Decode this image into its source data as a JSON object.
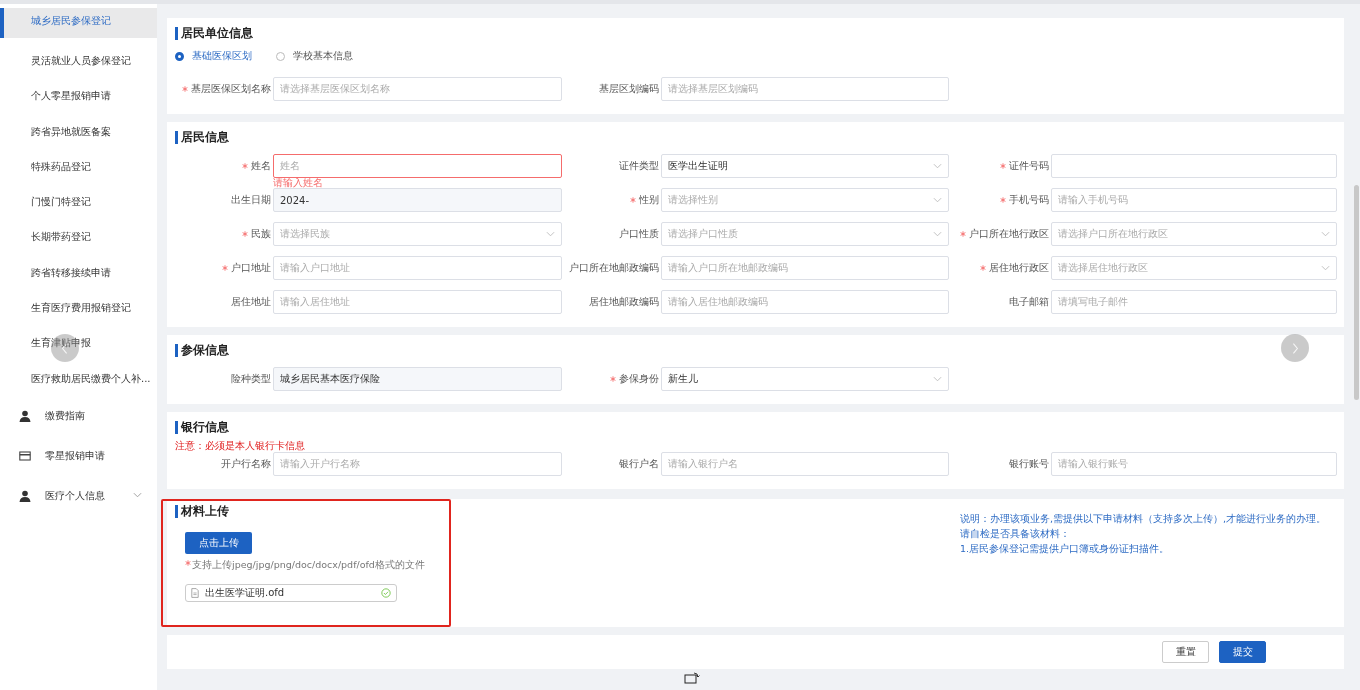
{
  "sidebar": {
    "items": [
      {
        "label": "城乡居民参保登记",
        "selected": true
      },
      {
        "label": "灵活就业人员参保登记",
        "selected": false
      },
      {
        "label": "个人零星报销申请",
        "selected": false
      },
      {
        "label": "跨省异地就医备案",
        "selected": false
      },
      {
        "label": "特殊药品登记",
        "selected": false
      },
      {
        "label": "门慢门特登记",
        "selected": false
      },
      {
        "label": "长期带药登记",
        "selected": false
      },
      {
        "label": "跨省转移接续申请",
        "selected": false
      },
      {
        "label": "生育医疗费用报销登记",
        "selected": false
      },
      {
        "label": "生育津贴申报",
        "selected": false
      },
      {
        "label": "医疗救助居民缴费个人补...",
        "selected": false
      }
    ],
    "menus": [
      {
        "kind": "person",
        "label": "缴费指南",
        "expandable": false
      },
      {
        "kind": "card",
        "label": "零星报销申请",
        "expandable": false
      },
      {
        "kind": "person",
        "label": "医疗个人信息",
        "expandable": true
      }
    ]
  },
  "sections": [
    {
      "title": "居民单位信息",
      "radios": [
        {
          "label": "基础医保区划",
          "selected": true
        },
        {
          "label": "学校基本信息",
          "selected": false
        }
      ],
      "fields": [
        {
          "label": "基层医保区划名称",
          "required": true,
          "kind": "input",
          "placeholder": "请选择基层医保区划名称"
        },
        {
          "label": "基层区划编码",
          "required": false,
          "kind": "input",
          "placeholder": "请选择基层区划编码"
        }
      ]
    },
    {
      "title": "居民信息",
      "fields": [
        {
          "label": "姓名",
          "required": true,
          "kind": "input",
          "placeholder": "姓名",
          "error": "请输入姓名"
        },
        {
          "label": "证件类型",
          "required": false,
          "kind": "select",
          "value": "医学出生证明"
        },
        {
          "label": "证件号码",
          "required": true,
          "kind": "input"
        },
        {
          "label": "出生日期",
          "required": false,
          "kind": "readonly",
          "value": "2024-"
        },
        {
          "label": "性别",
          "required": true,
          "kind": "select",
          "placeholder": "请选择性别"
        },
        {
          "label": "手机号码",
          "required": true,
          "kind": "input",
          "placeholder": "请输入手机号码"
        },
        {
          "label": "民族",
          "required": true,
          "kind": "select",
          "placeholder": "请选择民族"
        },
        {
          "label": "户口性质",
          "required": false,
          "kind": "select",
          "placeholder": "请选择户口性质"
        },
        {
          "label": "户口所在地行政区",
          "required": true,
          "kind": "select",
          "placeholder": "请选择户口所在地行政区"
        },
        {
          "label": "户口地址",
          "required": true,
          "kind": "input",
          "placeholder": "请输入户口地址"
        },
        {
          "label": "户口所在地邮政编码",
          "required": false,
          "kind": "input",
          "placeholder": "请输入户口所在地邮政编码"
        },
        {
          "label": "居住地行政区",
          "required": true,
          "kind": "select",
          "placeholder": "请选择居住地行政区"
        },
        {
          "label": "居住地址",
          "required": false,
          "kind": "input",
          "placeholder": "请输入居住地址"
        },
        {
          "label": "居住地邮政编码",
          "required": false,
          "kind": "input",
          "placeholder": "请输入居住地邮政编码"
        },
        {
          "label": "电子邮箱",
          "required": false,
          "kind": "input",
          "placeholder": "请填写电子邮件"
        }
      ]
    },
    {
      "title": "参保信息",
      "fields": [
        {
          "label": "险种类型",
          "required": false,
          "kind": "readonly",
          "value": "城乡居民基本医疗保险"
        },
        {
          "label": "参保身份",
          "required": true,
          "kind": "select",
          "value": "新生儿"
        }
      ]
    },
    {
      "title": "银行信息",
      "notice": "注意：必须是本人银行卡信息",
      "fields": [
        {
          "label": "开户行名称",
          "required": false,
          "kind": "input",
          "placeholder": "请输入开户行名称"
        },
        {
          "label": "银行户名",
          "required": false,
          "kind": "input",
          "placeholder": "请输入银行户名"
        },
        {
          "label": "银行账号",
          "required": false,
          "kind": "input",
          "placeholder": "请输入银行账号"
        }
      ]
    }
  ],
  "upload": {
    "title": "材料上传",
    "button": "点击上传",
    "hint": "支持上传jpeg/jpg/png/doc/docx/pdf/ofd格式的文件",
    "file": {
      "name": "出生医学证明.ofd",
      "done": true
    },
    "notes": [
      "说明：办理该项业务,需提供以下申请材料（支持多次上传）,才能进行业务的办理。",
      "请自检是否具备该材料：",
      "1.居民参保登记需提供户口簿或身份证扫描件。"
    ]
  },
  "footer": {
    "buttons": [
      "重置",
      "提交"
    ]
  }
}
